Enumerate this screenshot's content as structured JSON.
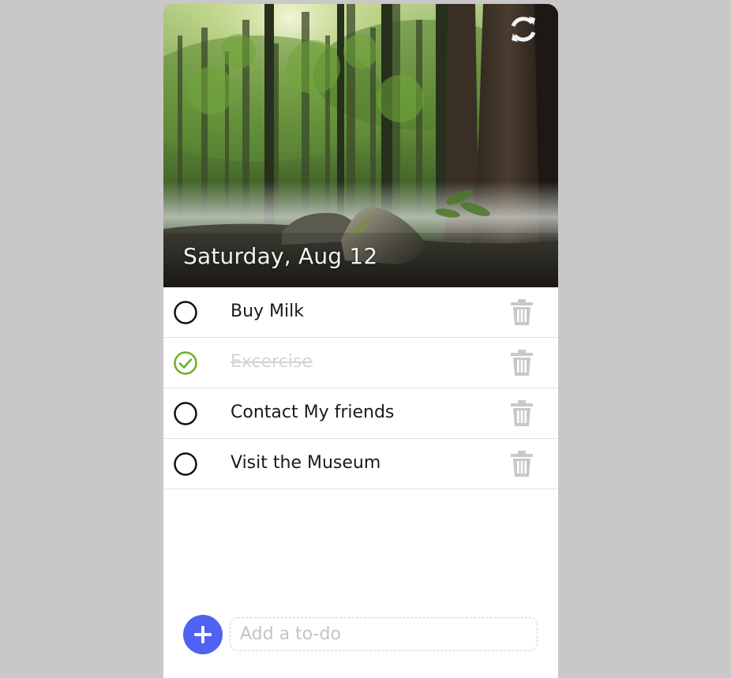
{
  "header": {
    "date": "Saturday, Aug 12",
    "refresh_icon": "refresh-icon",
    "background_image": "forest-photo"
  },
  "todos": [
    {
      "text": "Buy Milk",
      "done": false
    },
    {
      "text": "Excercise",
      "done": true
    },
    {
      "text": "Contact My friends",
      "done": false
    },
    {
      "text": "Visit the Museum",
      "done": false
    }
  ],
  "composer": {
    "add_icon": "plus-icon",
    "placeholder": "Add a to-do",
    "value": ""
  },
  "colors": {
    "page_background": "#c8c8c8",
    "accent": "#4f62f2",
    "done_check": "#6ab023",
    "trash": "#c8c8c8",
    "done_text": "#d4d4d4"
  }
}
